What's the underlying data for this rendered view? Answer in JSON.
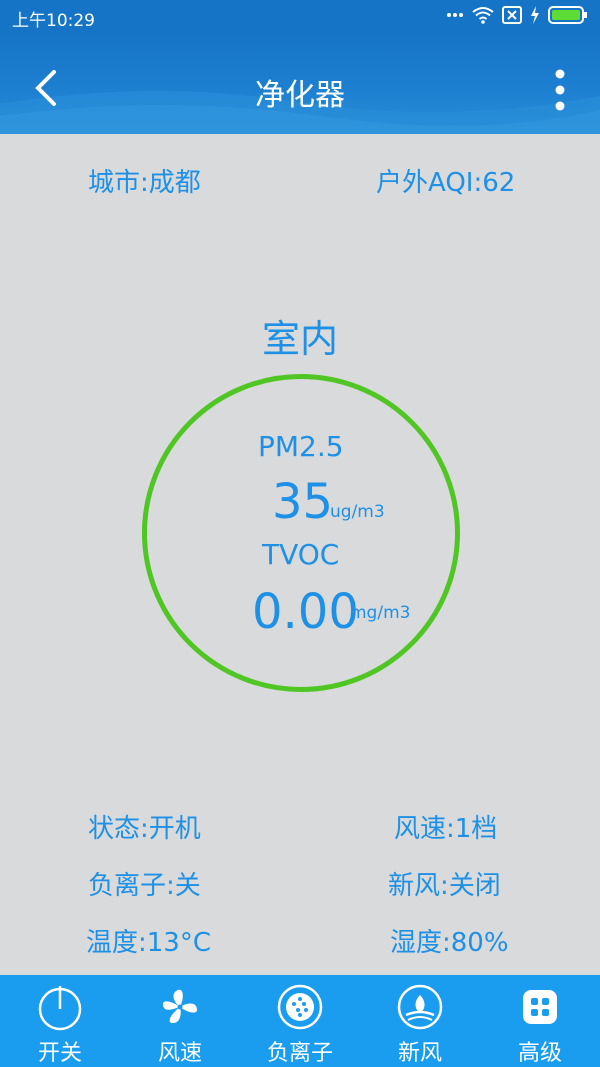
{
  "status_bar": {
    "time": "上午10:29"
  },
  "app_bar": {
    "title": "净化器"
  },
  "top_info": {
    "city": "城市:成都",
    "outdoor_aqi": "户外AQI:62"
  },
  "indoor": {
    "title": "室内",
    "pm25_label": "PM2.5",
    "pm25_value": "35",
    "pm25_unit": "ug/m3",
    "tvoc_label": "TVOC",
    "tvoc_value": "0.00",
    "tvoc_unit": "mg/m3"
  },
  "stats": {
    "state": "状态:开机",
    "fan_speed": "风速:1档",
    "anion": "负离子:关",
    "fresh_air": "新风:关闭",
    "temperature": "温度:13°C",
    "humidity": "湿度:80%"
  },
  "tabs": [
    {
      "label": "开关",
      "icon": "power-icon"
    },
    {
      "label": "风速",
      "icon": "fan-icon"
    },
    {
      "label": "负离子",
      "icon": "anion-icon"
    },
    {
      "label": "新风",
      "icon": "fresh-air-icon"
    },
    {
      "label": "高级",
      "icon": "grid-icon"
    }
  ],
  "colors": {
    "primary": "#1674c6",
    "text_blue": "#1e90e6",
    "ring_green": "#4fc623",
    "tabbar": "#1a9cef",
    "background": "#d9dadb"
  }
}
